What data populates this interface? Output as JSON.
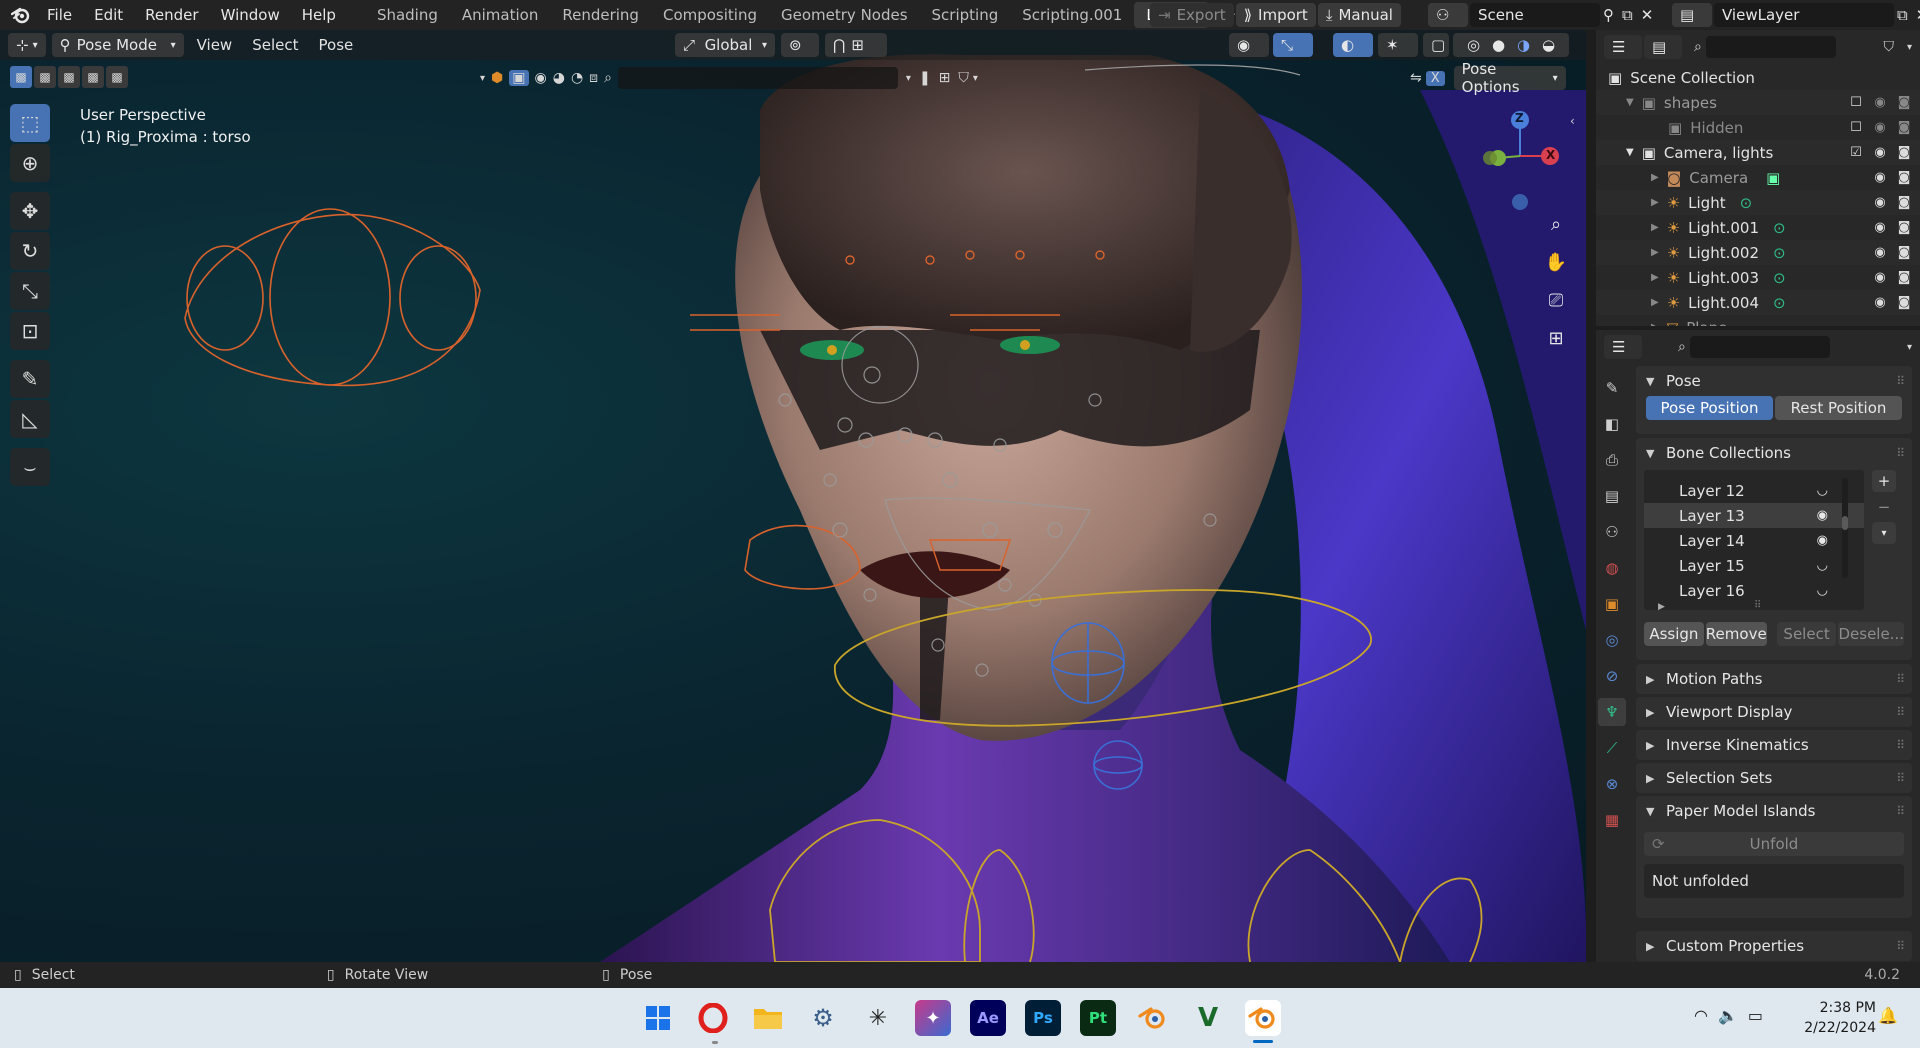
{
  "menu": {
    "file": "File",
    "edit": "Edit",
    "render": "Render",
    "window": "Window",
    "help": "Help"
  },
  "workspaces": [
    "Shading",
    "Animation",
    "Rendering",
    "Compositing",
    "Geometry Nodes",
    "Scripting",
    "Scripting.001",
    "Layout"
  ],
  "topright": {
    "export": "Export",
    "import": "Import",
    "manual": "Manual",
    "scene": "Scene",
    "view_layer": "ViewLayer"
  },
  "viewport": {
    "mode": "Pose Mode",
    "view": "View",
    "select": "Select",
    "pose": "Pose",
    "orientation": "Global",
    "pose_options": "Pose Options",
    "perspective": "User Perspective",
    "active": "(1) Rig_Proxima : torso",
    "gizmo": {
      "z": "Z",
      "x": "X"
    }
  },
  "outliner": {
    "root": "Scene Collection",
    "items": [
      {
        "label": "shapes"
      },
      {
        "label": "Hidden"
      },
      {
        "label": "Camera, lights"
      },
      {
        "label": "Camera"
      },
      {
        "label": "Light"
      },
      {
        "label": "Light.001"
      },
      {
        "label": "Light.002"
      },
      {
        "label": "Light.003"
      },
      {
        "label": "Light.004"
      },
      {
        "label": "Plane"
      }
    ]
  },
  "properties": {
    "pose_panel": "Pose",
    "pose_position": "Pose Position",
    "rest_position": "Rest Position",
    "bone_collections": "Bone Collections",
    "layers": [
      "Layer 12",
      "Layer 13",
      "Layer 14",
      "Layer 15",
      "Layer 16"
    ],
    "assign": "Assign",
    "remove": "Remove",
    "select": "Select",
    "deselect": "Desele...",
    "motion_paths": "Motion Paths",
    "viewport_display": "Viewport Display",
    "inverse_kinematics": "Inverse Kinematics",
    "selection_sets": "Selection Sets",
    "paper_model_islands": "Paper Model Islands",
    "unfold": "Unfold",
    "not_unfolded": "Not unfolded",
    "custom_properties": "Custom Properties"
  },
  "statusbar": {
    "select": "Select",
    "rotate_view": "Rotate View",
    "pose": "Pose",
    "version": "4.0.2"
  },
  "taskbar": {
    "apps": [
      "Ae",
      "Ps",
      "Pt"
    ],
    "time": "2:38 PM",
    "date": "2/22/2024"
  },
  "colors": {
    "accent": "#4772b3",
    "bone_orange": "#d9622b",
    "bone_yellow": "#c9a52a",
    "bone_blue": "#3a6fd6",
    "hair": "#4b38c8"
  }
}
